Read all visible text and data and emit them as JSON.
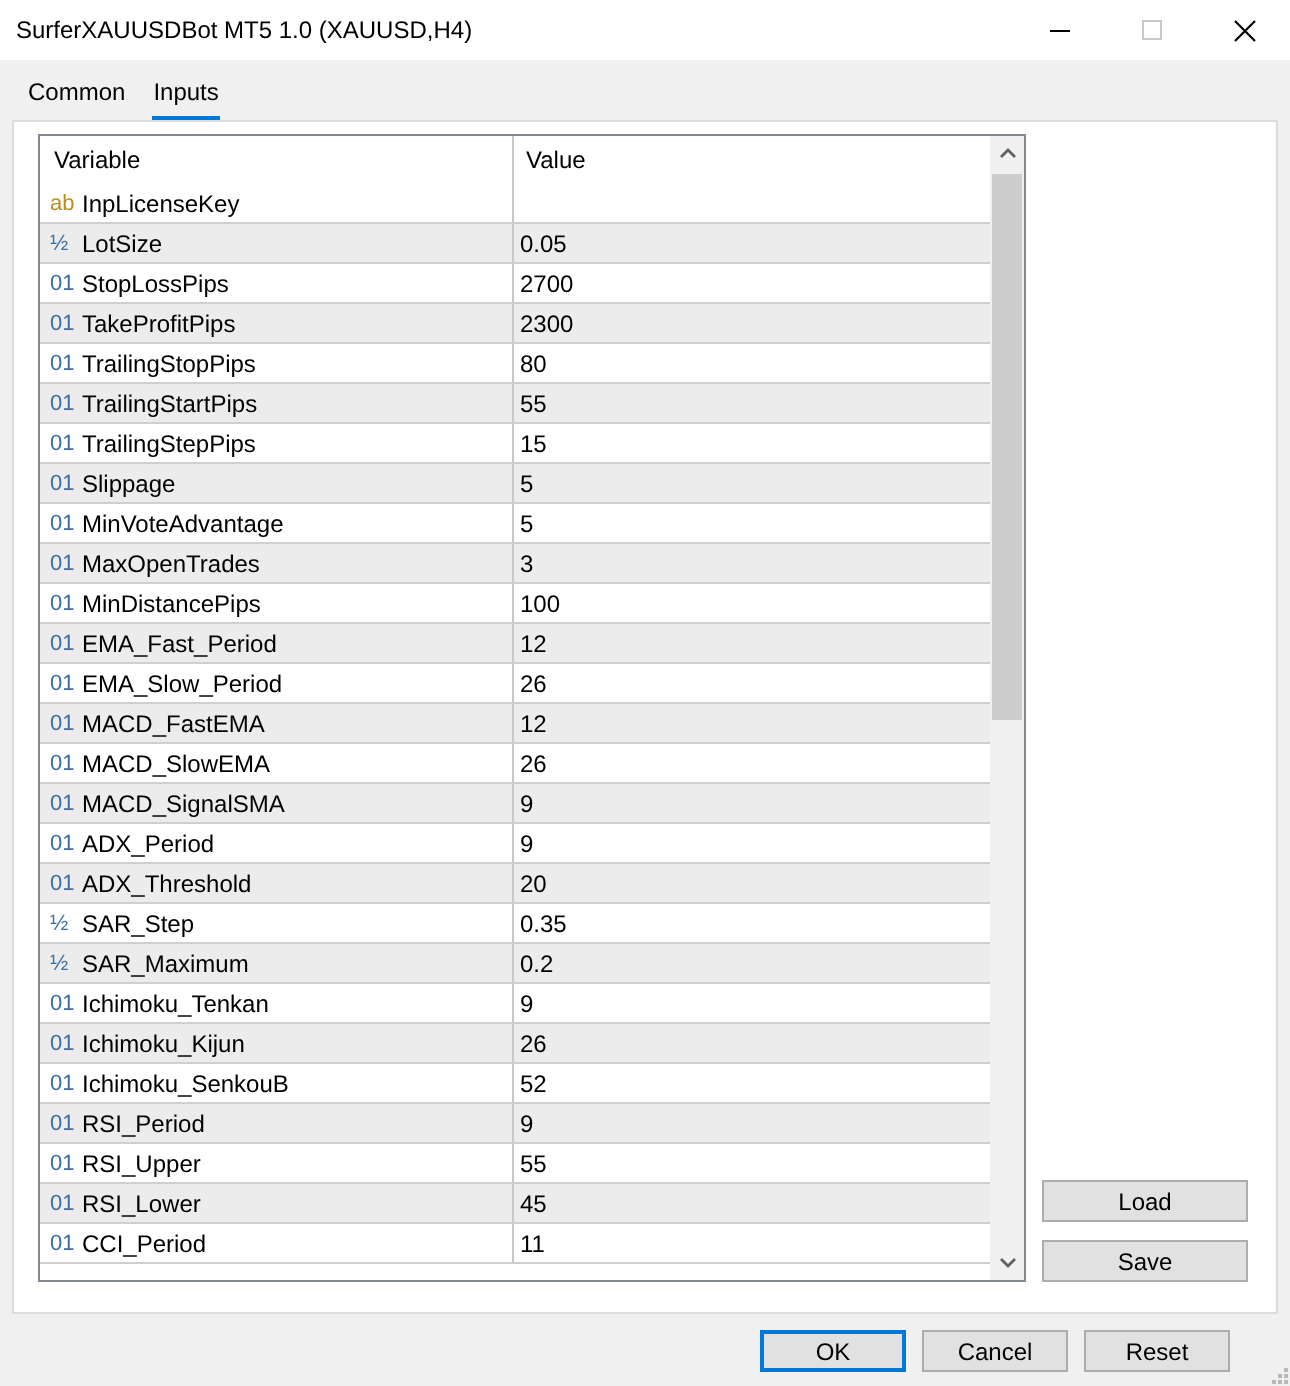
{
  "window": {
    "title": "SurferXAUUSDBot MT5 1.0 (XAUUSD,H4)",
    "maximize_disabled": true
  },
  "tabs": [
    {
      "label": "Common",
      "selected": false
    },
    {
      "label": "Inputs",
      "selected": true
    }
  ],
  "inputs_table": {
    "columns": [
      "Variable",
      "Value"
    ],
    "rows": [
      {
        "kind": "string",
        "icon": "ab",
        "variable": "InpLicenseKey"
      },
      {
        "kind": "double",
        "icon": "½",
        "variable": "LotSize",
        "value": "0.05"
      },
      {
        "kind": "integer",
        "icon": "01",
        "variable": "StopLossPips",
        "value": "2700"
      },
      {
        "kind": "integer",
        "icon": "01",
        "variable": "TakeProfitPips",
        "value": "2300"
      },
      {
        "kind": "integer",
        "icon": "01",
        "variable": "TrailingStopPips",
        "value": "80"
      },
      {
        "kind": "integer",
        "icon": "01",
        "variable": "TrailingStartPips",
        "value": "55"
      },
      {
        "kind": "integer",
        "icon": "01",
        "variable": "TrailingStepPips",
        "value": "15"
      },
      {
        "kind": "integer",
        "icon": "01",
        "variable": "Slippage",
        "value": "5"
      },
      {
        "kind": "integer",
        "icon": "01",
        "variable": "MinVoteAdvantage",
        "value": "5"
      },
      {
        "kind": "integer",
        "icon": "01",
        "variable": "MaxOpenTrades",
        "value": "3"
      },
      {
        "kind": "integer",
        "icon": "01",
        "variable": "MinDistancePips",
        "value": "100"
      },
      {
        "kind": "integer",
        "icon": "01",
        "variable": "EMA_Fast_Period",
        "value": "12"
      },
      {
        "kind": "integer",
        "icon": "01",
        "variable": "EMA_Slow_Period",
        "value": "26"
      },
      {
        "kind": "integer",
        "icon": "01",
        "variable": "MACD_FastEMA",
        "value": "12"
      },
      {
        "kind": "integer",
        "icon": "01",
        "variable": "MACD_SlowEMA",
        "value": "26"
      },
      {
        "kind": "integer",
        "icon": "01",
        "variable": "MACD_SignalSMA",
        "value": "9"
      },
      {
        "kind": "integer",
        "icon": "01",
        "variable": "ADX_Period",
        "value": "9"
      },
      {
        "kind": "integer",
        "icon": "01",
        "variable": "ADX_Threshold",
        "value": "20"
      },
      {
        "kind": "double",
        "icon": "½",
        "variable": "SAR_Step",
        "value": "0.35"
      },
      {
        "kind": "double",
        "icon": "½",
        "variable": "SAR_Maximum",
        "value": "0.2"
      },
      {
        "kind": "integer",
        "icon": "01",
        "variable": "Ichimoku_Tenkan",
        "value": "9"
      },
      {
        "kind": "integer",
        "icon": "01",
        "variable": "Ichimoku_Kijun",
        "value": "26"
      },
      {
        "kind": "integer",
        "icon": "01",
        "variable": "Ichimoku_SenkouB",
        "value": "52"
      },
      {
        "kind": "integer",
        "icon": "01",
        "variable": "RSI_Period",
        "value": "9"
      },
      {
        "kind": "integer",
        "icon": "01",
        "variable": "RSI_Upper",
        "value": "55"
      },
      {
        "kind": "integer",
        "icon": "01",
        "variable": "RSI_Lower",
        "value": "45"
      },
      {
        "kind": "integer",
        "icon": "01",
        "variable": "CCI_Period",
        "value": "11"
      }
    ]
  },
  "side_buttons": [
    "Load",
    "Save"
  ],
  "dialog_buttons": [
    {
      "label": "OK",
      "default": true
    },
    {
      "label": "Cancel",
      "default": false
    },
    {
      "label": "Reset",
      "default": false
    }
  ]
}
